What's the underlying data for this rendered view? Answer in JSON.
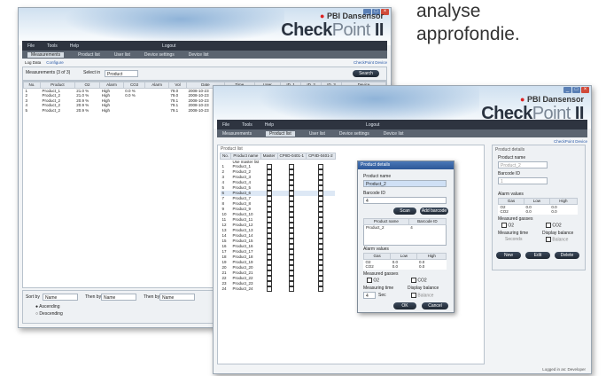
{
  "caption": {
    "lines": [
      "analyse",
      "approfondie."
    ]
  },
  "brand": {
    "company": "PBI Dansensor",
    "product_main": "Check",
    "product_point": "Point",
    "product_version": "II"
  },
  "window1": {
    "menu": [
      "File",
      "Tools",
      "Help",
      "Logout"
    ],
    "tabs": [
      "Measurements",
      "Product list",
      "User list",
      "Device settings",
      "Device list"
    ],
    "active_tab": "Measurements",
    "status_right": "CheckPoint Device",
    "log_label": "Log Data",
    "log_link": "Configure",
    "filters": {
      "period_label": "Measurements (3 of 3)",
      "select_label": "Select in",
      "select_value": "Product",
      "search_button": "Search"
    },
    "columns": [
      "No.",
      "Product",
      "O2",
      "Alarm",
      "CO2",
      "Alarm",
      "Vol",
      "Date",
      "Time",
      "User",
      "ID_1",
      "ID_2",
      "ID_3",
      "Device"
    ],
    "rows": [
      [
        "1",
        "Product_1",
        "21.0 %",
        "High",
        "0.0 %",
        "",
        "79.0",
        "2008-10-23",
        "09:51:45",
        "User_1",
        "",
        "",
        "",
        "CPIID-0401-1"
      ],
      [
        "2",
        "Product_2",
        "21.0 %",
        "High",
        "0.0 %",
        "",
        "79.0",
        "2008-10-23",
        "09:53:40",
        "User_1",
        "",
        "",
        "",
        "CPIID-0401-1"
      ],
      [
        "3",
        "Product_2",
        "20.9 %",
        "High",
        "",
        "",
        "79.1",
        "2008-10-23",
        "09:56:55",
        "User_1",
        "",
        "",
        "",
        "CPIID-0401-1"
      ],
      [
        "4",
        "Product_2",
        "20.9 %",
        "High",
        "",
        "",
        "79.1",
        "2008-10-23",
        "11:44:40",
        "User_1",
        "",
        "",
        "",
        "CPIID-0401-1"
      ],
      [
        "5",
        "Product_2",
        "20.9 %",
        "High",
        "",
        "",
        "79.1",
        "2008-10-23",
        "13:56:03",
        "User_1",
        "",
        "",
        "",
        "CPIID-0401-1"
      ]
    ],
    "sort": {
      "sort_by_label": "Sort by",
      "sort_by_value": "Name",
      "then_by_label": "Then by",
      "then_by_value": "Name",
      "then_by2_label": "Then by",
      "then_by2_value": "Name",
      "ascending": "Ascending",
      "descending": "Descending"
    }
  },
  "window2": {
    "menu": [
      "File",
      "Tools",
      "Help",
      "Logout"
    ],
    "tabs": [
      "Measurements",
      "Product list",
      "User list",
      "Device settings",
      "Device list"
    ],
    "active_tab": "Product list",
    "status_right": "CheckPoint Device",
    "list_label": "Product list",
    "columns": [
      "No.",
      "Product name",
      "Master",
      "CPIID-0401-1",
      "CPIID-0401-2"
    ],
    "new_product_row": "Use master list",
    "products": [
      "Product_1",
      "Product_2",
      "Product_3",
      "Product_4",
      "Product_5",
      "Product_6",
      "Product_7",
      "Product_8",
      "Product_9",
      "Product_10",
      "Product_11",
      "Product_12",
      "Product_13",
      "Product_14",
      "Product_15",
      "Product_16",
      "Product_17",
      "Product_18",
      "Product_19",
      "Product_20",
      "Product_21",
      "Product_22",
      "Product_23",
      "Product_24"
    ],
    "selected_index": 5,
    "side": {
      "title": "Product details",
      "name_label": "Product name",
      "name_value": "Product_2",
      "barcode_label": "Barcode ID",
      "barcode_value": "1",
      "alarm_label": "Alarm values",
      "alarm_cols": [
        "Gas",
        "Low",
        "High"
      ],
      "alarm_rows": [
        [
          "O2",
          "0.0",
          "0.0"
        ],
        [
          "CO2",
          "0.0",
          "0.0"
        ]
      ],
      "measured_label": "Measured gasses",
      "o2": "O2",
      "co2": "CO2",
      "time_label": "Measuring time",
      "display_label": "Display balance",
      "seconds": "Seconds",
      "balance": "Balance",
      "buttons": [
        "New",
        "Edit",
        "Delete"
      ]
    },
    "dialog": {
      "title": "Product details",
      "name_label": "Product name",
      "name_value": "Product_2",
      "barcode_label": "Barcode ID",
      "barcode_value": "4",
      "scan_button": "Scan",
      "add_barcode_button": "Add barcode",
      "list_cols": [
        "Product name",
        "Barcode ID"
      ],
      "list_rows": [
        [
          "Product_2",
          "4"
        ]
      ],
      "alarm_label": "Alarm values",
      "alarm_cols": [
        "Gas",
        "Low",
        "High"
      ],
      "alarm_rows": [
        [
          "O2",
          "0.0",
          "0.0"
        ],
        [
          "CO2",
          "0.0",
          "0.0"
        ]
      ],
      "measured_label": "Measured gasses",
      "o2": "O2",
      "co2": "CO2",
      "time_label": "Measuring time",
      "time_value": "4",
      "time_unit": "Sec",
      "display_label": "Display balance",
      "balance": "Balance",
      "ok": "OK",
      "cancel": "Cancel"
    },
    "status_bottom": "Logged in as: Developer"
  }
}
